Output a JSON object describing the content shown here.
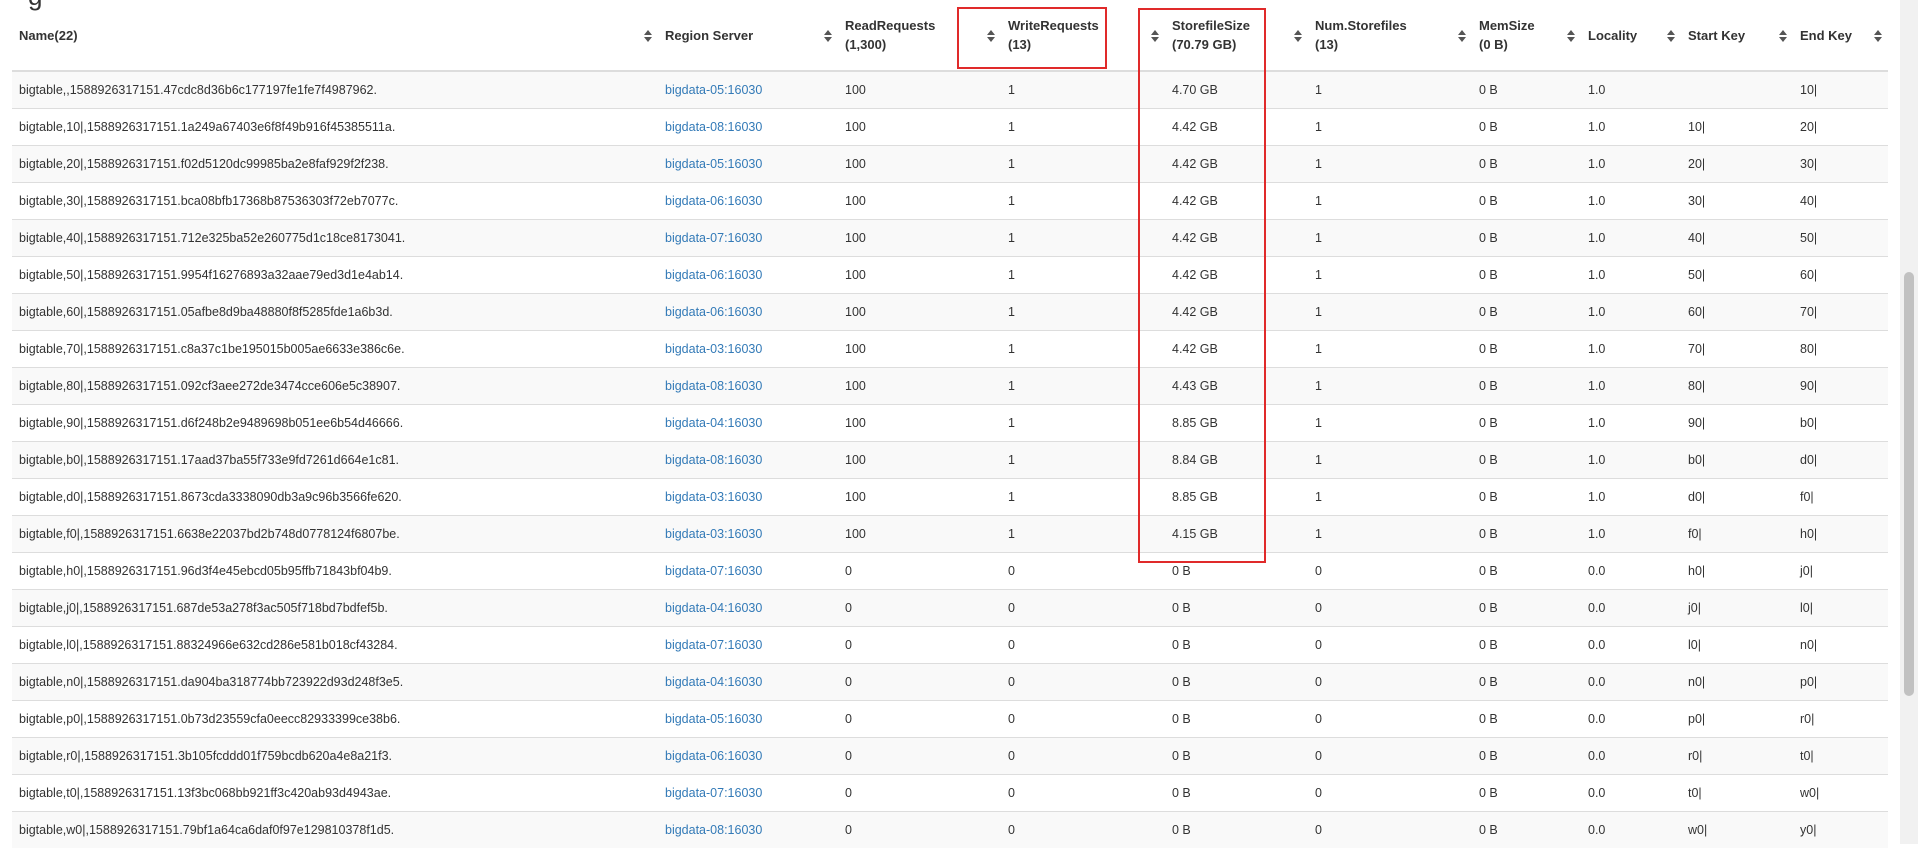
{
  "page": {
    "top_fragment": "g"
  },
  "table": {
    "headers": [
      {
        "label": "Name(22)"
      },
      {
        "label": "Region Server"
      },
      {
        "label": "ReadRequests",
        "sub": "(1,300)"
      },
      {
        "label": "WriteRequests",
        "sub": "(13)"
      },
      {
        "label": "StorefileSize",
        "sub": "(70.79 GB)"
      },
      {
        "label": "Num.Storefiles",
        "sub": "(13)"
      },
      {
        "label": "MemSize",
        "sub": "(0 B)"
      },
      {
        "label": "Locality"
      },
      {
        "label": "Start Key"
      },
      {
        "label": "End Key"
      }
    ],
    "rows": [
      [
        "bigtable,,1588926317151.47cdc8d36b6c177197fe1fe7f4987962.",
        "bigdata-05:16030",
        "100",
        "1",
        "4.70 GB",
        "1",
        "0 B",
        "1.0",
        "",
        "10|"
      ],
      [
        "bigtable,10|,1588926317151.1a249a67403e6f8f49b916f45385511a.",
        "bigdata-08:16030",
        "100",
        "1",
        "4.42 GB",
        "1",
        "0 B",
        "1.0",
        "10|",
        "20|"
      ],
      [
        "bigtable,20|,1588926317151.f02d5120dc99985ba2e8faf929f2f238.",
        "bigdata-05:16030",
        "100",
        "1",
        "4.42 GB",
        "1",
        "0 B",
        "1.0",
        "20|",
        "30|"
      ],
      [
        "bigtable,30|,1588926317151.bca08bfb17368b87536303f72eb7077c.",
        "bigdata-06:16030",
        "100",
        "1",
        "4.42 GB",
        "1",
        "0 B",
        "1.0",
        "30|",
        "40|"
      ],
      [
        "bigtable,40|,1588926317151.712e325ba52e260775d1c18ce8173041.",
        "bigdata-07:16030",
        "100",
        "1",
        "4.42 GB",
        "1",
        "0 B",
        "1.0",
        "40|",
        "50|"
      ],
      [
        "bigtable,50|,1588926317151.9954f16276893a32aae79ed3d1e4ab14.",
        "bigdata-06:16030",
        "100",
        "1",
        "4.42 GB",
        "1",
        "0 B",
        "1.0",
        "50|",
        "60|"
      ],
      [
        "bigtable,60|,1588926317151.05afbe8d9ba48880f8f5285fde1a6b3d.",
        "bigdata-06:16030",
        "100",
        "1",
        "4.42 GB",
        "1",
        "0 B",
        "1.0",
        "60|",
        "70|"
      ],
      [
        "bigtable,70|,1588926317151.c8a37c1be195015b005ae6633e386c6e.",
        "bigdata-03:16030",
        "100",
        "1",
        "4.42 GB",
        "1",
        "0 B",
        "1.0",
        "70|",
        "80|"
      ],
      [
        "bigtable,80|,1588926317151.092cf3aee272de3474cce606e5c38907.",
        "bigdata-08:16030",
        "100",
        "1",
        "4.43 GB",
        "1",
        "0 B",
        "1.0",
        "80|",
        "90|"
      ],
      [
        "bigtable,90|,1588926317151.d6f248b2e9489698b051ee6b54d46666.",
        "bigdata-04:16030",
        "100",
        "1",
        "8.85 GB",
        "1",
        "0 B",
        "1.0",
        "90|",
        "b0|"
      ],
      [
        "bigtable,b0|,1588926317151.17aad37ba55f733e9fd7261d664e1c81.",
        "bigdata-08:16030",
        "100",
        "1",
        "8.84 GB",
        "1",
        "0 B",
        "1.0",
        "b0|",
        "d0|"
      ],
      [
        "bigtable,d0|,1588926317151.8673cda3338090db3a9c96b3566fe620.",
        "bigdata-03:16030",
        "100",
        "1",
        "8.85 GB",
        "1",
        "0 B",
        "1.0",
        "d0|",
        "f0|"
      ],
      [
        "bigtable,f0|,1588926317151.6638e22037bd2b748d0778124f6807be.",
        "bigdata-03:16030",
        "100",
        "1",
        "4.15 GB",
        "1",
        "0 B",
        "1.0",
        "f0|",
        "h0|"
      ],
      [
        "bigtable,h0|,1588926317151.96d3f4e45ebcd05b95ffb71843bf04b9.",
        "bigdata-07:16030",
        "0",
        "0",
        "0 B",
        "0",
        "0 B",
        "0.0",
        "h0|",
        "j0|"
      ],
      [
        "bigtable,j0|,1588926317151.687de53a278f3ac505f718bd7bdfef5b.",
        "bigdata-04:16030",
        "0",
        "0",
        "0 B",
        "0",
        "0 B",
        "0.0",
        "j0|",
        "l0|"
      ],
      [
        "bigtable,l0|,1588926317151.88324966e632cd286e581b018cf43284.",
        "bigdata-07:16030",
        "0",
        "0",
        "0 B",
        "0",
        "0 B",
        "0.0",
        "l0|",
        "n0|"
      ],
      [
        "bigtable,n0|,1588926317151.da904ba318774bb723922d93d248f3e5.",
        "bigdata-04:16030",
        "0",
        "0",
        "0 B",
        "0",
        "0 B",
        "0.0",
        "n0|",
        "p0|"
      ],
      [
        "bigtable,p0|,1588926317151.0b73d23559cfa0eecc82933399ce38b6.",
        "bigdata-05:16030",
        "0",
        "0",
        "0 B",
        "0",
        "0 B",
        "0.0",
        "p0|",
        "r0|"
      ],
      [
        "bigtable,r0|,1588926317151.3b105fcddd01f759bcdb620a4e8a21f3.",
        "bigdata-06:16030",
        "0",
        "0",
        "0 B",
        "0",
        "0 B",
        "0.0",
        "r0|",
        "t0|"
      ],
      [
        "bigtable,t0|,1588926317151.13f3bc068bb921ff3c420ab93d4943ae.",
        "bigdata-07:16030",
        "0",
        "0",
        "0 B",
        "0",
        "0 B",
        "0.0",
        "t0|",
        "w0|"
      ],
      [
        "bigtable,w0|,1588926317151.79bf1a64ca6daf0f97e129810378f1d5.",
        "bigdata-08:16030",
        "0",
        "0",
        "0 B",
        "0",
        "0 B",
        "0.0",
        "w0|",
        "y0|"
      ]
    ]
  },
  "colors": {
    "link": "#337ab7",
    "highlight": "#e02a2a",
    "stripe": "#f9f9f9",
    "border": "#dddddd"
  }
}
